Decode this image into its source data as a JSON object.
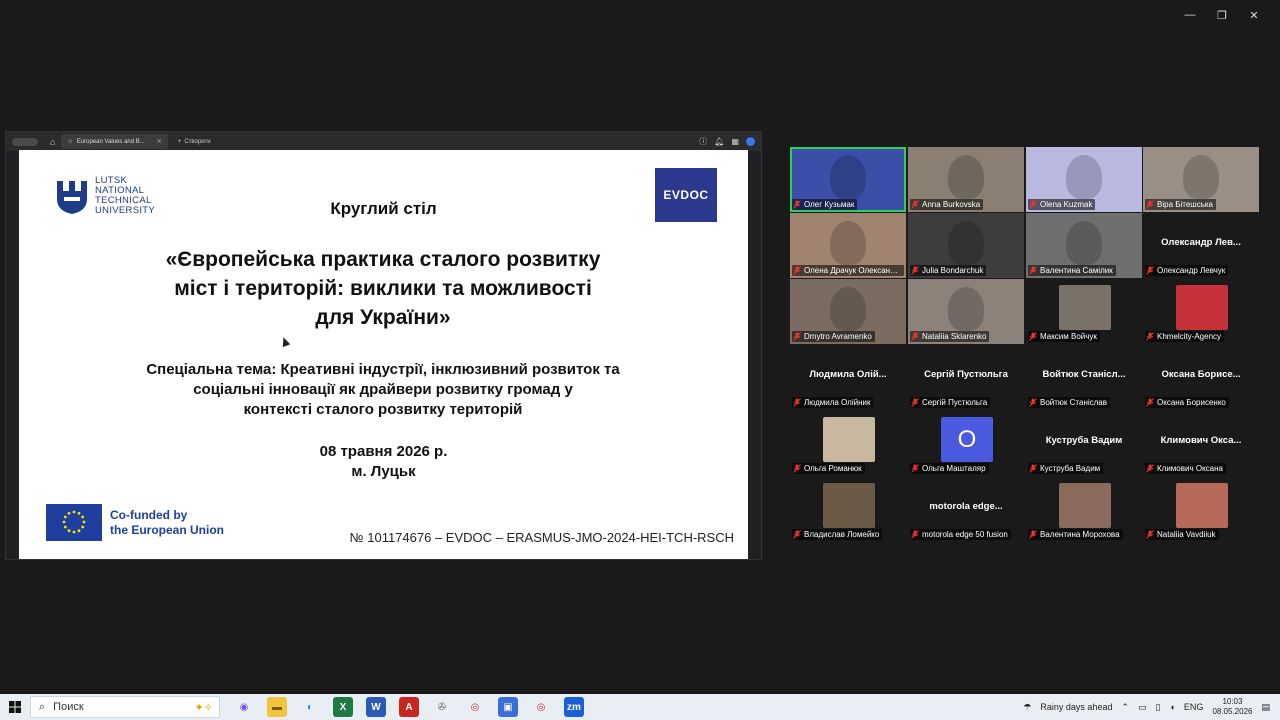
{
  "window_controls": {
    "minimize": "—",
    "maximize": "❐",
    "close": "✕"
  },
  "browser": {
    "tab_title": "European Values and B...",
    "new_tab_label": "Створити"
  },
  "slide": {
    "university": [
      "LUTSK",
      "NATIONAL",
      "TECHNICAL",
      "UNIVERSITY"
    ],
    "evdoc_logo": "EVDOC",
    "event_type": "Круглий стіл",
    "title_lines": [
      "«Європейська практика сталого розвитку",
      "міст і територій: виклики та можливості",
      "для України»"
    ],
    "special_lines": [
      "Спеціальна тема: Креативні індустрії, інклюзивний розвиток та",
      "соціальні інновації як драйвери розвитку громад у",
      "контексті сталого розвитку територій"
    ],
    "date": "08 травня 2026 р.",
    "city": "м. Луцьк",
    "eu_lines": [
      "Co-funded by",
      "the European Union"
    ],
    "grant": "№ 101174676 – EVDOC – ERASMUS-JMO-2024-HEI-TCH-RSCH"
  },
  "participants": [
    {
      "name": "Олег Кузьмак",
      "type": "video",
      "color": "#3b4fa8",
      "active": true
    },
    {
      "name": "Anna Burkovska",
      "type": "video",
      "color": "#8a7f72"
    },
    {
      "name": "Olena Kuzmak",
      "type": "video",
      "color": "#b9b9e0"
    },
    {
      "name": "Віра Бітешська",
      "type": "video",
      "color": "#9a8f84"
    },
    {
      "name": "Олена Драчук Олександрівна",
      "type": "video",
      "color": "#a08470"
    },
    {
      "name": "Julia Bondarchuk",
      "type": "video",
      "color": "#3d3d3d"
    },
    {
      "name": "Валентина Самілик",
      "type": "video",
      "color": "#6f6f6f"
    },
    {
      "name": "Олександр Левчук",
      "type": "name",
      "big": "Олександр Лев..."
    },
    {
      "name": "Dmytro Avramenko",
      "type": "video",
      "color": "#7a6d60"
    },
    {
      "name": "Nataliia Sklarenko",
      "type": "video",
      "color": "#8c8178"
    },
    {
      "name": "Максим Войчук",
      "type": "avatar",
      "color": "#7a7268"
    },
    {
      "name": "Khmelcity-Agency",
      "type": "avatar",
      "color": "#c7323a"
    },
    {
      "name": "Людмила Олійник",
      "type": "name",
      "big": "Людмила Олій..."
    },
    {
      "name": "Сергiй Пустюльга",
      "type": "name",
      "big": "Сергій Пустюльга"
    },
    {
      "name": "Войтюк Станіслав",
      "type": "name",
      "big": "Войтюк Станісл..."
    },
    {
      "name": "Оксана Борисенко",
      "type": "name",
      "big": "Оксана Борисе..."
    },
    {
      "name": "Ольга Романюк",
      "type": "avatar",
      "color": "#c8b8a0"
    },
    {
      "name": "Ольга Маштaляр",
      "type": "letter",
      "letter": "O"
    },
    {
      "name": "Куструба Вадим",
      "type": "name",
      "big": "Куструба Вадим"
    },
    {
      "name": "Климович Оксана",
      "type": "name",
      "big": "Климович Окса..."
    },
    {
      "name": "Владислав Ломейко",
      "type": "avatar",
      "color": "#6b5a45"
    },
    {
      "name": "motorola edge 50 fusion",
      "type": "name",
      "big": "motorola edge..."
    },
    {
      "name": "Валентина Морохова",
      "type": "avatar",
      "color": "#8a6a5a"
    },
    {
      "name": "Nataliia Vavdiiuk",
      "type": "avatar",
      "color": "#b86a5a"
    }
  ],
  "taskbar": {
    "search_placeholder": "Поиск",
    "weather": "Rainy days ahead",
    "language": "ENG",
    "time": "10:03",
    "date": "08.05.2026"
  }
}
